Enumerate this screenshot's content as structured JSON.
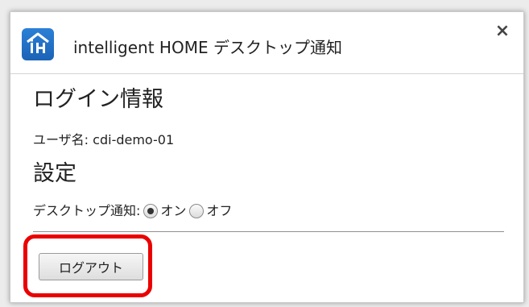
{
  "window": {
    "title": "intelligent HOME デスクトップ通知",
    "close_symbol": "×"
  },
  "login": {
    "heading": "ログイン情報",
    "username_label": "ユーザ名:",
    "username_value": "cdi-demo-01"
  },
  "settings": {
    "heading": "設定",
    "notification_label": "デスクトップ通知:",
    "options": [
      {
        "label": "オン",
        "selected": true
      },
      {
        "label": "オフ",
        "selected": false
      }
    ]
  },
  "actions": {
    "logout_label": "ログアウト"
  },
  "colors": {
    "highlight": "#ea0000",
    "logo_blue": "#1c63b6"
  },
  "icons": {
    "logo": "ih-logo-icon",
    "close": "close-icon"
  }
}
